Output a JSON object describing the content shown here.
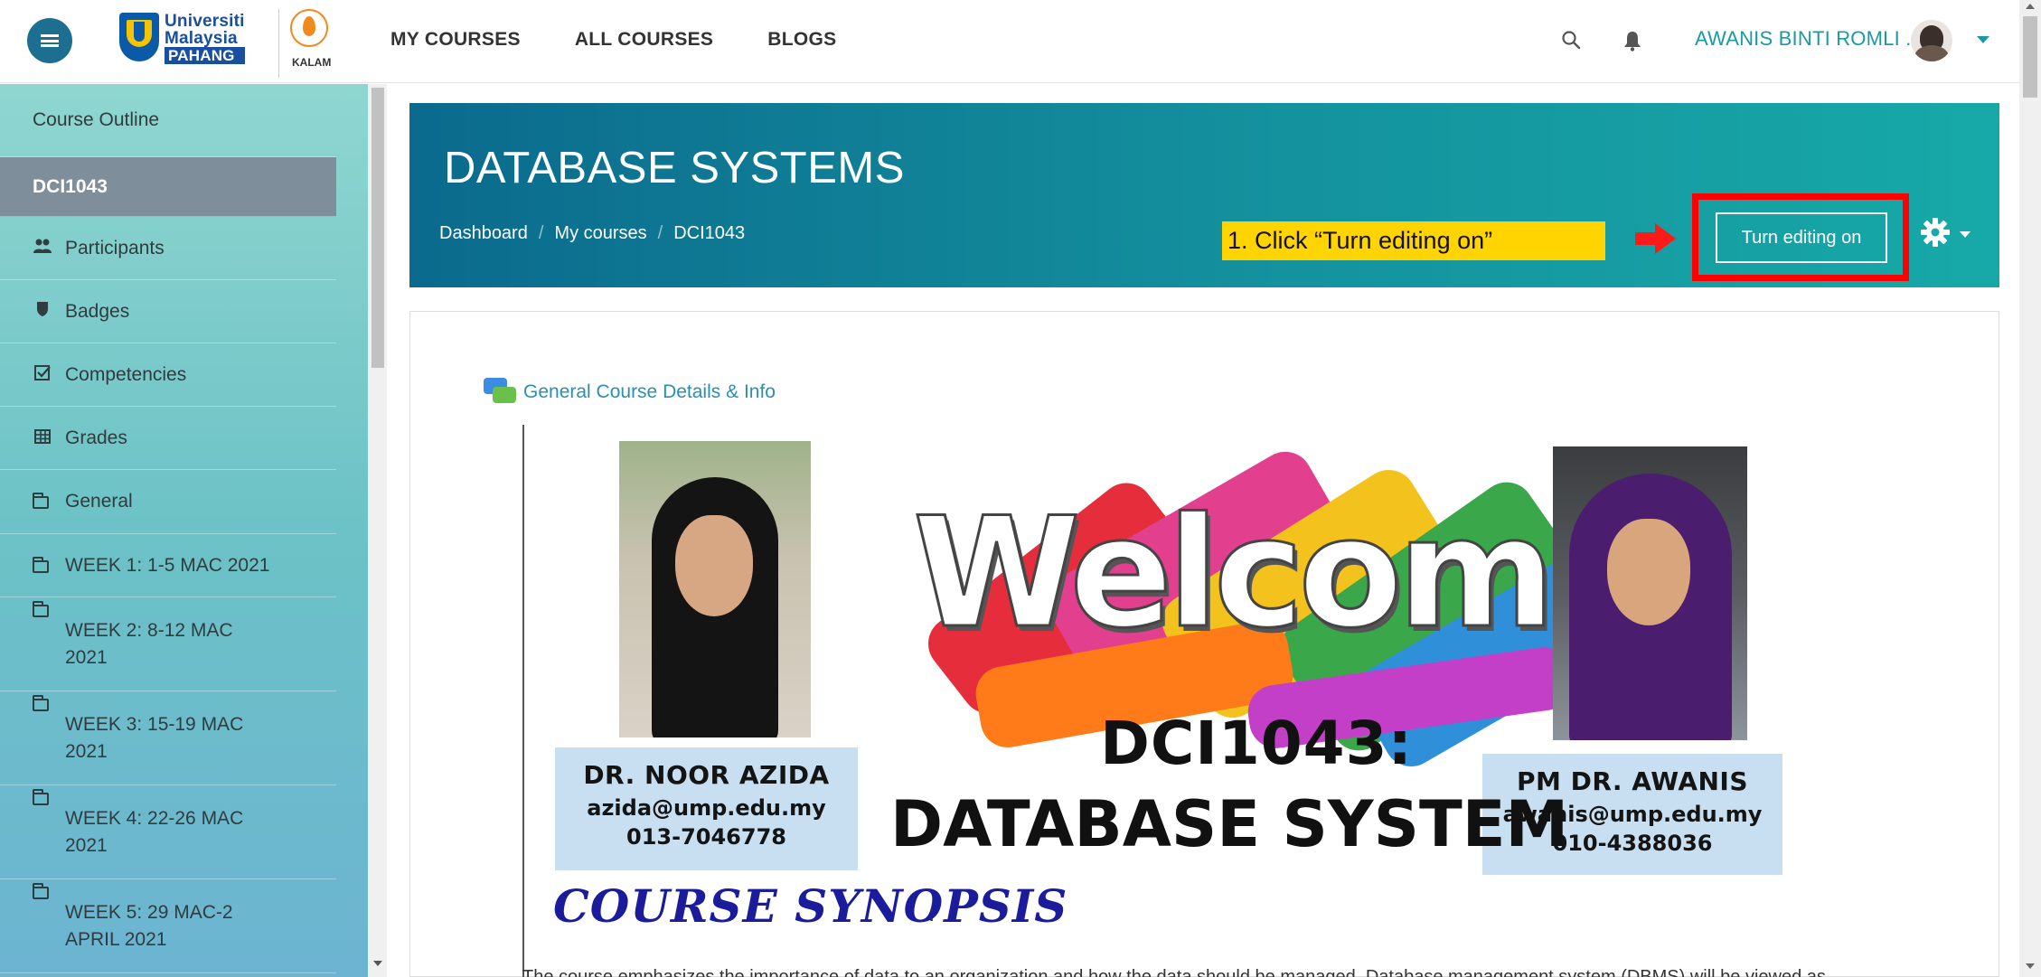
{
  "navbar": {
    "logo_ump_lines": [
      "Universiti",
      "Malaysia",
      "PAHANG"
    ],
    "logo_kalam": "KALAM",
    "links": [
      "MY COURSES",
      "ALL COURSES",
      "BLOGS"
    ],
    "user_name": "AWANIS BINTI ROMLI .",
    "icons": [
      "menu-icon",
      "search-icon",
      "bell-icon",
      "caret-down-icon"
    ]
  },
  "drawer": {
    "items": [
      {
        "label": "Course Outline",
        "icon": ""
      },
      {
        "label": "DCI1043",
        "icon": "",
        "active": true
      },
      {
        "label": "Participants",
        "icon": "users-icon"
      },
      {
        "label": "Badges",
        "icon": "shield-icon"
      },
      {
        "label": "Competencies",
        "icon": "checkbox-icon"
      },
      {
        "label": "Grades",
        "icon": "table-icon"
      },
      {
        "label": "General",
        "icon": "folder-icon"
      },
      {
        "label": "WEEK 1: 1-5 MAC 2021",
        "icon": "folder-icon"
      },
      {
        "label": "WEEK 2: 8-12 MAC 2021",
        "icon": "folder-icon"
      },
      {
        "label": "WEEK 3: 15-19 MAC 2021",
        "icon": "folder-icon"
      },
      {
        "label": "WEEK 4: 22-26 MAC 2021",
        "icon": "folder-icon"
      },
      {
        "label": "WEEK 5: 29 MAC-2 APRIL 2021",
        "icon": "folder-icon"
      }
    ]
  },
  "header": {
    "title": "DATABASE SYSTEMS",
    "breadcrumb": [
      "Dashboard",
      "My courses",
      "DCI1043"
    ],
    "edit_button": "Turn editing on",
    "annotation": "1. Click  “Turn editing on”",
    "colors": {
      "accent": "#1a9aa3",
      "header_start": "#0b6a8d",
      "header_end": "#17a9a8",
      "annotation_bg": "#ffd400",
      "annotation_box": "#ff0000"
    }
  },
  "content": {
    "forum_link": "General Course Details & Info",
    "banner": {
      "welcome": "Welcome",
      "course_code": "DCI1043:",
      "course_name": "DATABASE SYSTEM",
      "left_name": "DR. NOOR AZIDA",
      "left_email": "azida@ump.edu.my",
      "left_phone": "013-7046778",
      "right_name": "PM DR. AWANIS",
      "right_email": "awanis@ump.edu.my",
      "right_phone": "010-4388036"
    },
    "synopsis_title": "COURSE SYNOPSIS",
    "synopsis_colon": ":",
    "synopsis_text": "The course emphasizes the importance of data to an organization and how the data should be managed. Database management system (DBMS) will be viewed as"
  }
}
